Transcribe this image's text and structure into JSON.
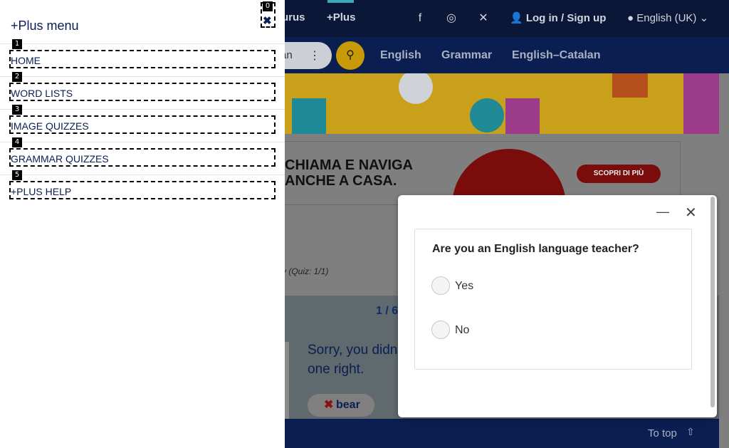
{
  "topnav": {
    "thesaurus_partial": "urus",
    "plus": "+Plus",
    "login": "Log in",
    "login_sep": "/",
    "signup": "Sign up",
    "language": "English (UK)"
  },
  "search": {
    "partial_value": "an",
    "tabs": [
      "English",
      "Grammar",
      "English–Catalan"
    ]
  },
  "ad": {
    "line1": "CHIAMA E NAVIGA",
    "line2": "ANCHE A CASA.",
    "cta": "SCOPRI DI PIÙ"
  },
  "quiz": {
    "meta": "sy (Quiz: 1/1)",
    "count": "1 / 6",
    "feedback": "Sorry, you didn one right.",
    "answer": "bear"
  },
  "footer": {
    "to_top": "To top"
  },
  "popup": {
    "question": "Are you an English language teacher?",
    "options": [
      "Yes",
      "No"
    ]
  },
  "sidemenu": {
    "title": "+Plus menu",
    "items": [
      "HOME",
      "WORD LISTS",
      "IMAGE QUIZZES",
      "GRAMMAR QUIZZES",
      "+PLUS HELP"
    ],
    "badges": [
      "0",
      "1",
      "2",
      "3",
      "4",
      "5"
    ]
  },
  "colors": {
    "navy": "#0a1e52",
    "gold": "#c99a07",
    "white": "#ffffff"
  }
}
